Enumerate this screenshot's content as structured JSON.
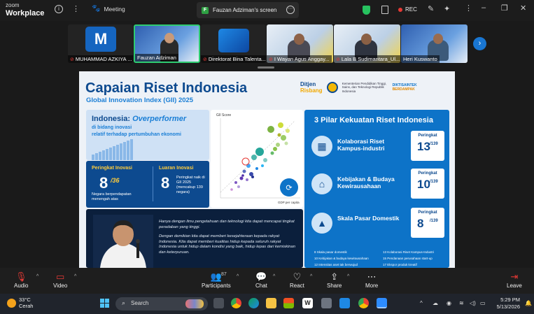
{
  "titlebar": {
    "brand_top": "zoom",
    "brand_bottom": "Workplace",
    "meeting_label": "Meeting",
    "screen_label": "Fauzan Adziman's screen",
    "rec_label": "REC"
  },
  "participants": [
    {
      "name": "MUHAMMAD AZKIYA ...",
      "avatar_letter": "M",
      "muted": true
    },
    {
      "name": "Fauzan Adziman",
      "muted": false
    },
    {
      "name": "Direktorat Bina Talenta...",
      "muted": true
    },
    {
      "name": "I Wayan Agus Anggay...",
      "muted": true
    },
    {
      "name": "Lala B Sudimantara_Ul...",
      "muted": true
    },
    {
      "name": "Heri Kuswanto",
      "muted": false
    }
  ],
  "slide": {
    "title": "Capaian Riset Indonesia",
    "subtitle": "Global Innovation Index (GII) 2025",
    "logo_ditjen_1": "Ditjen",
    "logo_ditjen_2": "Risbang",
    "logo_kem": "Kementerian Pendidikan Tinggi, Sains, dan Teknologi Republik Indonesia",
    "logo_db_1": "DIKTISAINTEK",
    "logo_db_2": "BERDAMPAK",
    "over_title_1": "Indonesia: ",
    "over_title_2": "Overperformer",
    "over_line1": "di bidang inovasi",
    "over_line2": "relatif terhadap pertumbuhan ekonomi",
    "rank_label1": "Peringkat Inovasi",
    "rank_value1": "8",
    "rank_suffix1": "/36",
    "rank_desc1": "Negara berpendapatan menengah atas",
    "rank_label2": "Luaran Inovasi",
    "rank_value2": "8",
    "rank_desc2": "Peringkat naik di GII 2025 (mencakup 139 negara)",
    "scatter_ylabel": "GII Score",
    "scatter_xlabel": "GDP per capita",
    "pilar_title": "3 Pilar Kekuatan Riset Indonesia",
    "pillars": [
      {
        "label": "Kolaborasi Riset Kampus-industri",
        "rank_label": "Peringkat",
        "rank": "13",
        "of": "/139",
        "icon": "building-icon"
      },
      {
        "label": "Kebijakan & Budaya Kewirausahaan",
        "rank_label": "Peringkat",
        "rank": "10",
        "of": "/139",
        "icon": "store-icon"
      },
      {
        "label": "Skala Pasar Domestik",
        "rank_label": "Peringkat",
        "rank": "8",
        "of": "/139",
        "icon": "growth-chart-icon"
      }
    ],
    "pillar_list": [
      "8  Skala pasar domestik",
      "13  Kolaborasi Riset Kampus-Industri",
      "10  Kebijakan & budaya kewirausahaan",
      "15  Pendanaan perusahaan start-up",
      "12  Intensitas aset tak berwujud",
      "17  Ekspor produk kreatif"
    ],
    "quote_p1": "Hanya dengan ilmu pengetahuan dan teknologi kita dapat mencapai tingkat peradaban yang tinggi.",
    "quote_p2": "Dengan demikian kita dapat memberi kesejahteraan kepada rakyat Indonesia. Kita dapat memberi kualitas hidup kepada seluruh rakyat Indonesia untuk hidup dalam kondisi yang baik, hidup lepas dari kemiskinan dan keterpuruan."
  },
  "toolbar": {
    "audio": "Audio",
    "video": "Video",
    "participants": "Participants",
    "participants_count": "87",
    "chat": "Chat",
    "react": "React",
    "share": "Share",
    "more": "More",
    "leave": "Leave"
  },
  "taskbar": {
    "temp": "33°C",
    "weather": "Cerah",
    "search": "Search",
    "time": "5:29 PM",
    "date": "5/13/2026"
  },
  "colors": {
    "slide_dark_blue": "#0d4a8f",
    "slide_accent_blue": "#1b7fd6",
    "slide_yellow": "#ffcd3c",
    "zoom_blue": "#1976d2",
    "recording_red": "#e53935"
  }
}
